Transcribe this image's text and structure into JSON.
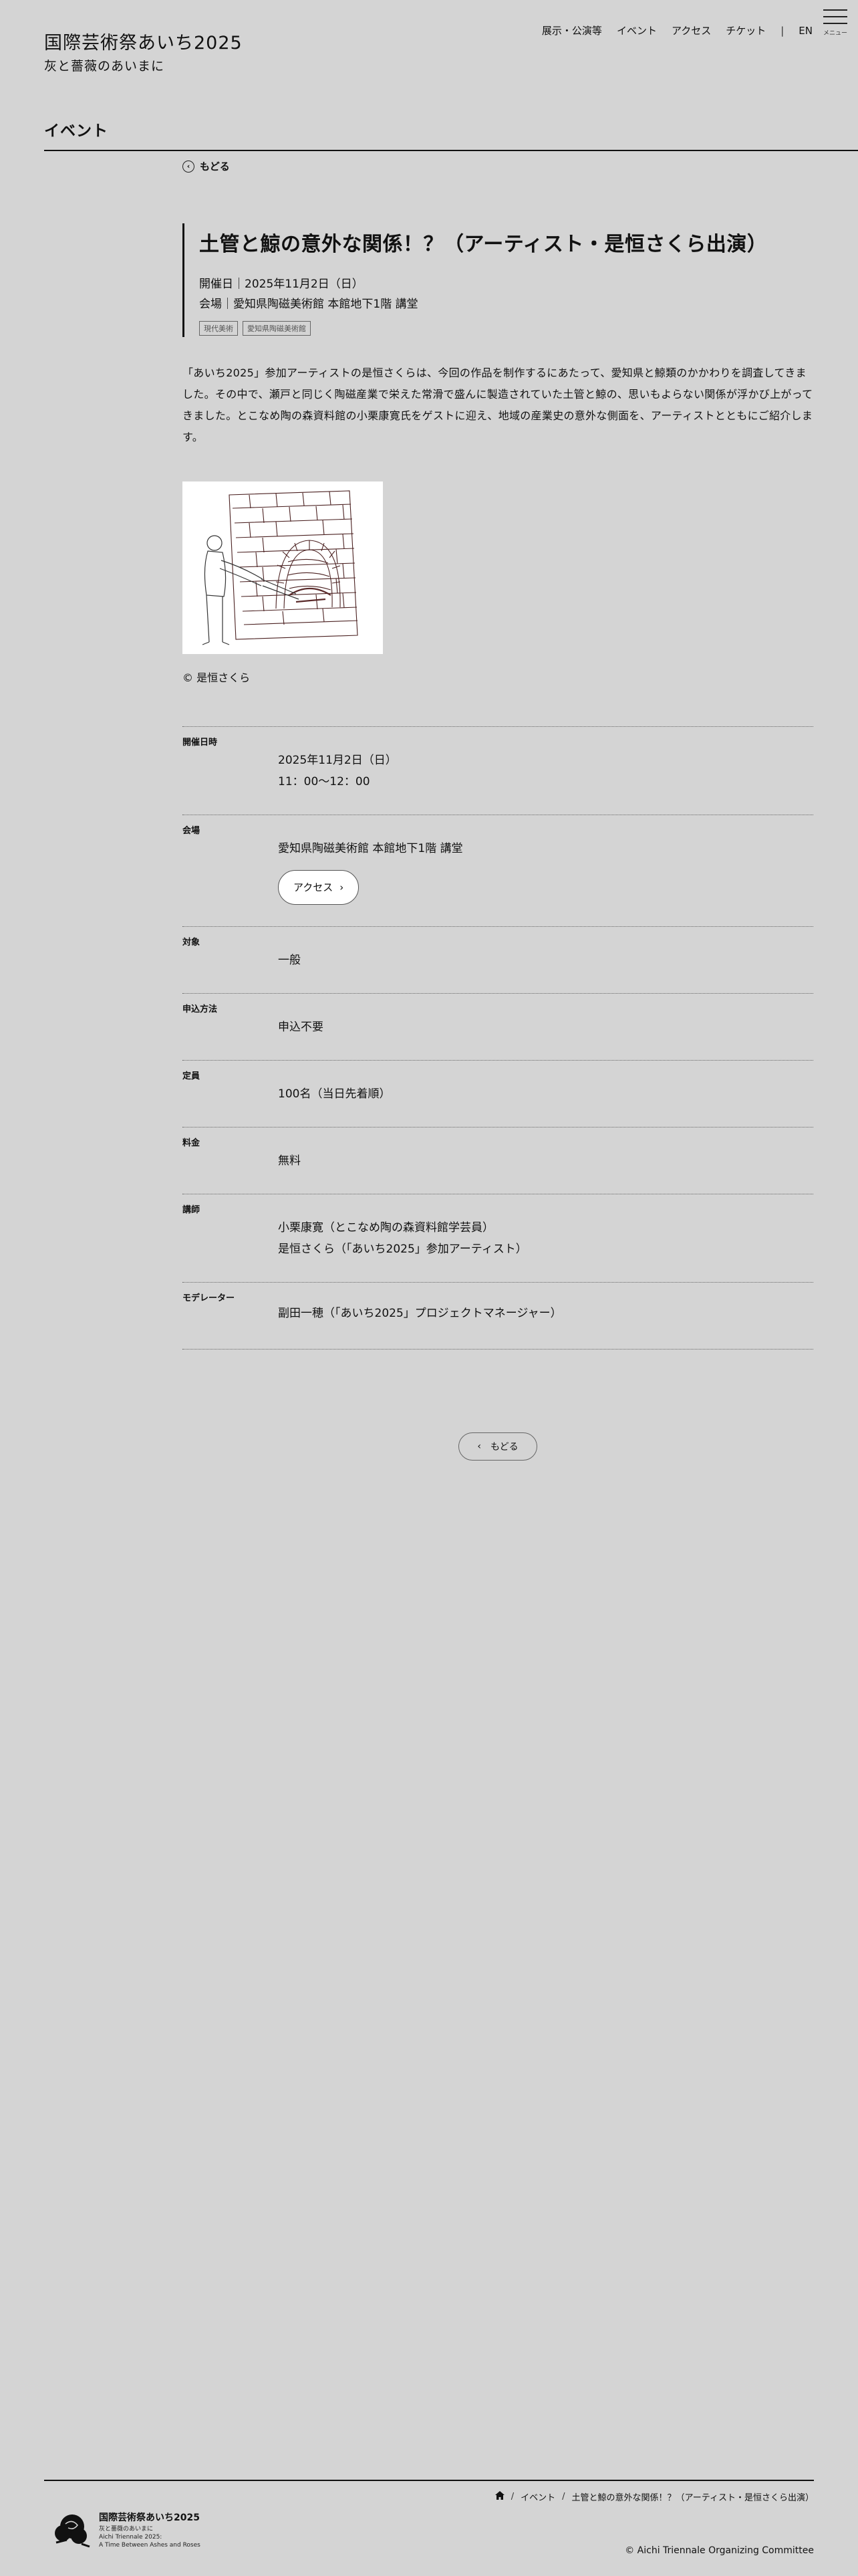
{
  "header": {
    "site_title": "国際芸術祭あいち2025",
    "site_subtitle": "灰と薔薇のあいまに",
    "nav": [
      "展示・公演等",
      "イベント",
      "アクセス",
      "チケット"
    ],
    "nav_separator": "|",
    "lang": "EN",
    "menu_label": "メニュー"
  },
  "page": {
    "section_title": "イベント",
    "back_label": "もどる"
  },
  "event": {
    "title": "土管と鯨の意外な関係！？（アーティスト・是恒さくら出演）",
    "date_line": "開催日｜2025年11月2日（日）",
    "venue_line": "会場｜愛知県陶磁美術館 本館地下1階 講堂",
    "tags": [
      "現代美術",
      "愛知県陶磁美術館"
    ],
    "intro": "「あいち2025」参加アーティストの是恒さくらは、今回の作品を制作するにあたって、愛知県と鯨類のかかわりを調査してきました。その中で、瀬戸と同じく陶磁産業で栄えた常滑で盛んに製造されていた土管と鯨の、思いもよらない関係が浮かび上がってきました。とこなめ陶の森資料館の小栗康寛氏をゲストに迎え、地域の産業史の意外な側面を、アーティストとともにご紹介します。",
    "image_credit": "© 是恒さくら"
  },
  "details": {
    "date_label": "開催日時",
    "date_value": "2025年11月2日（日）",
    "time_value": "11：00〜12：00",
    "venue_label": "会場",
    "venue_value": "愛知県陶磁美術館 本館地下1階 講堂",
    "access_button": "アクセス",
    "target_label": "対象",
    "target_value": "一般",
    "apply_label": "申込方法",
    "apply_value": "申込不要",
    "capacity_label": "定員",
    "capacity_value": "100名（当日先着順）",
    "fee_label": "料金",
    "fee_value": "無料",
    "lecturer_label": "講師",
    "lecturer_1": "小栗康寛（とこなめ陶の森資料館学芸員）",
    "lecturer_2": "是恒さくら（「あいち2025」参加アーティスト）",
    "moderator_label": "モデレーター",
    "moderator_value": "副田一穂（「あいち2025」プロジェクトマネージャー）"
  },
  "footer": {
    "breadcrumb": [
      "イベント",
      "土管と鯨の意外な関係！？（アーティスト・是恒さくら出演）"
    ],
    "breadcrumb_separator": "/",
    "logo_name": "国際芸術祭あいち2025",
    "logo_sub_1": "灰と薔薇のあいまに",
    "logo_sub_2": "Aichi Triennale 2025:",
    "logo_sub_3": "A Time Between Ashes and Roses",
    "copyright": "© Aichi Triennale Organizing Committee"
  }
}
